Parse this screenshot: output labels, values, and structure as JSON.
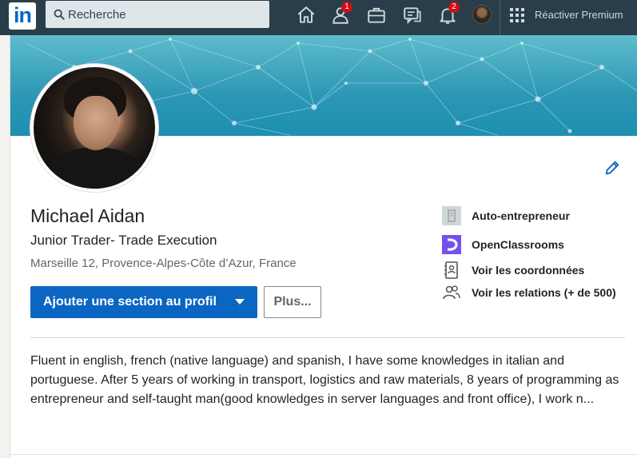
{
  "nav": {
    "logo": "in",
    "search_placeholder": "Recherche",
    "network_badge": "1",
    "notifications_badge": "2",
    "premium_label": "Réactiver Premium"
  },
  "profile": {
    "name": "Michael Aidan",
    "headline": "Junior Trader- Trade Execution",
    "location": "Marseille 12, Provence-Alpes-Côte d’Azur, France",
    "add_section_label": "Ajouter une section au profil",
    "more_label": "Plus...",
    "about": "Fluent in english, french (native language) and spanish, I have some knowledges in italian and portuguese. After 5 years of working in transport, logistics and raw materials, 8 years of programming as entrepreneur and self-taught man(good knowledges in server languages and front office), I work n..."
  },
  "side_items": [
    {
      "label": "Auto-entrepreneur",
      "icon": "company-icon"
    },
    {
      "label": "OpenClassrooms",
      "icon": "openclassrooms-logo"
    },
    {
      "label": "Voir les coordonnées",
      "icon": "contact-card-icon"
    },
    {
      "label": "Voir les relations (+ de 500)",
      "icon": "connections-icon"
    }
  ],
  "colors": {
    "nav_bg": "#293e4a",
    "primary": "#0a66c2",
    "badge": "#cc1016",
    "openclassrooms": "#7451eb"
  }
}
